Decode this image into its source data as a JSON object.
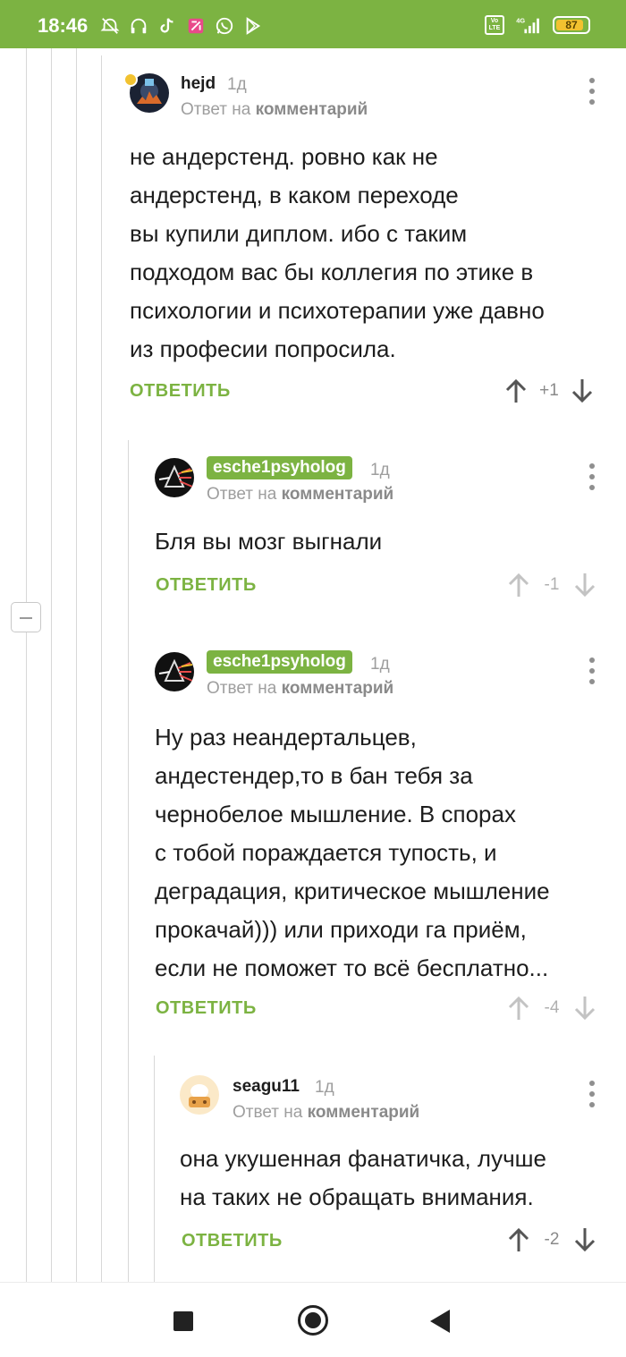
{
  "status_bar": {
    "time": "18:46",
    "left_icons": [
      "alarm-off-icon",
      "headphones-icon",
      "tiktok-icon",
      "app-icon",
      "whatsapp-icon",
      "play-store-icon"
    ],
    "volte_label": "Vo LTE",
    "network": "4G",
    "battery": "87",
    "accent_color": "#7cb342",
    "battery_color": "#f2c230"
  },
  "comments": [
    {
      "username": "hejd",
      "age": "1д",
      "reply_prefix": "Ответ на",
      "reply_target": "комментарий",
      "body": "не андерстенд. ровно как не\nандерстенд, в каком переходе\nвы купили диплом. ибо с таким\nподходом вас бы коллегия  по этике в\nпсихологии и психотерапии уже давно\nиз професии попросила.",
      "reply_label": "ОТВЕТИТЬ",
      "score": "+1"
    },
    {
      "username": "esche1psyholog",
      "age": "1д",
      "reply_prefix": "Ответ на",
      "reply_target": "комментарий",
      "body": "Бля вы мозг выгнали",
      "reply_label": "ОТВЕТИТЬ",
      "score": "-1"
    },
    {
      "username": "esche1psyholog",
      "age": "1д",
      "reply_prefix": "Ответ на",
      "reply_target": "комментарий",
      "body": "Ну раз неандертальцев,\nандестендер,то в бан тебя за\nчернобелое мышление. В спорах\nс тобой пораждается тупость, и\nдеградация, критическое мышление\nпрокачай))) или приходи га приём,\nесли не поможет то всё бесплатно...",
      "reply_label": "ОТВЕТИТЬ",
      "score": "-4"
    },
    {
      "username": "seagu11",
      "age": "1д",
      "reply_prefix": "Ответ на",
      "reply_target": "комментарий",
      "body": "она укушенная фанатичка, лучше\nна таких не обращать внимания.",
      "reply_label": "ОТВЕТИТЬ",
      "score": "-2"
    }
  ],
  "nav_bar": {
    "buttons": [
      "recents-button",
      "home-button",
      "back-button"
    ]
  }
}
